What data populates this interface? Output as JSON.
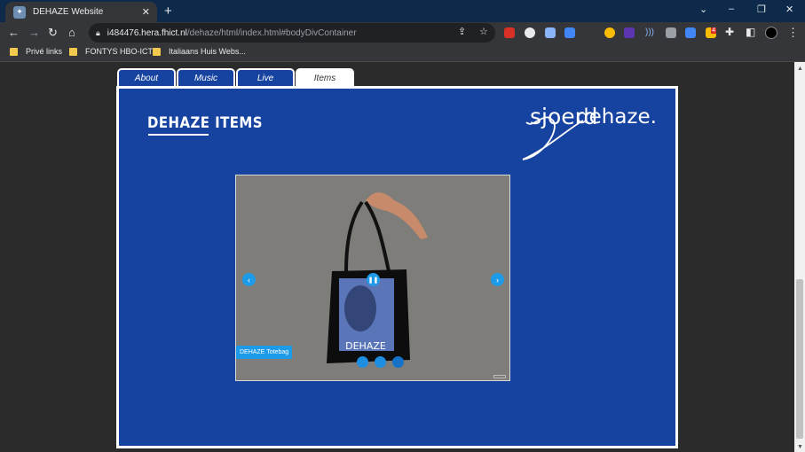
{
  "browser": {
    "tab_title": "DEHAZE Website",
    "new_tab": "+",
    "url_host": "i484476.hera.fhict.nl",
    "url_path": "/dehaze/html/index.html#bodyDivContainer",
    "bookmarks": [
      "Privé links",
      "FONTYS HBO-ICT",
      "Italiaans Huis Webs..."
    ],
    "icons": {
      "back": "arrow-left-icon",
      "forward": "arrow-right-icon",
      "reload": "reload-icon",
      "home": "home-icon",
      "lock": "lock-icon",
      "share": "share-icon",
      "star": "star-icon",
      "extensions": "puzzle-icon",
      "menu": "kebab-menu-icon"
    },
    "extension_badge": "4"
  },
  "site": {
    "nav_tabs": [
      {
        "label": "About",
        "active": false
      },
      {
        "label": "Music",
        "active": false
      },
      {
        "label": "Live",
        "active": false
      },
      {
        "label": "Items",
        "active": true
      }
    ],
    "section_title": "DEHAZE ITEMS",
    "logo_text": "dehaze.",
    "logo_script": "sjoerd",
    "slideshow": {
      "product_label": "DEHAZE",
      "caption": "DEHAZE Totebag",
      "prev_icon": "chevron-left-icon",
      "next_icon": "chevron-right-icon",
      "pause_icon": "pause-icon",
      "dot_count": 3,
      "active_dot": 3
    }
  },
  "colors": {
    "brand_blue": "#1642a0",
    "accent": "#1e9be8",
    "slide_bg": "#7f7d7a",
    "tab_bar": "#0d2a4a"
  }
}
